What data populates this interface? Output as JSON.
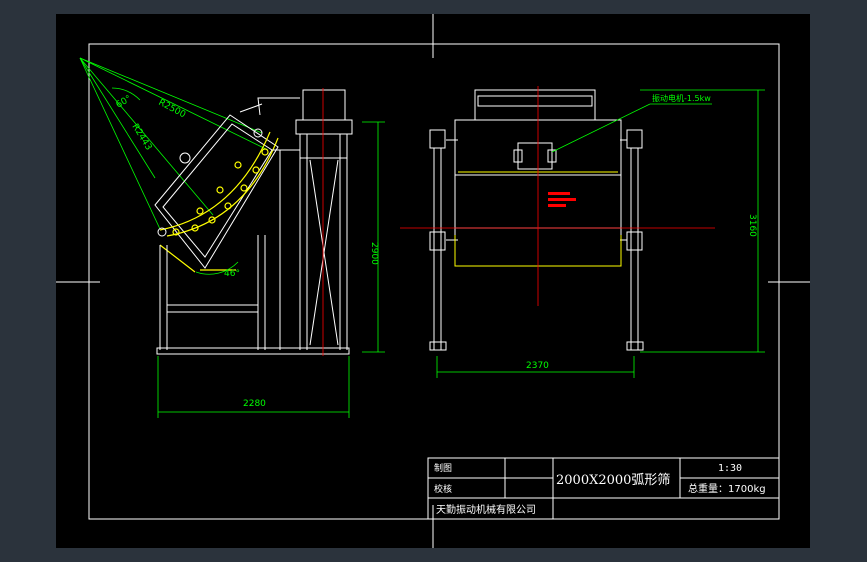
{
  "title_block": {
    "drawn_label": "制图",
    "checked_label": "校核",
    "drawing_title": "2000X2000弧形筛",
    "scale": "1:30",
    "weight": "总重量：1700kg",
    "company": "天勤振动机械有限公司"
  },
  "side_view": {
    "angle_60": "60°",
    "angle_46": "46°",
    "radius_upper": "R2500",
    "radius_lower": "R2443",
    "dim_width": "2280",
    "dim_height": "2900"
  },
  "front_view": {
    "motor_label": "振动电机-1.5kw",
    "dim_width": "2370",
    "dim_height": "3160"
  },
  "colors": {
    "frame": "#ffffff",
    "dimension": "#00ff00",
    "centerline": "#ff0000",
    "curve": "#ffff00",
    "background": "#000000"
  }
}
